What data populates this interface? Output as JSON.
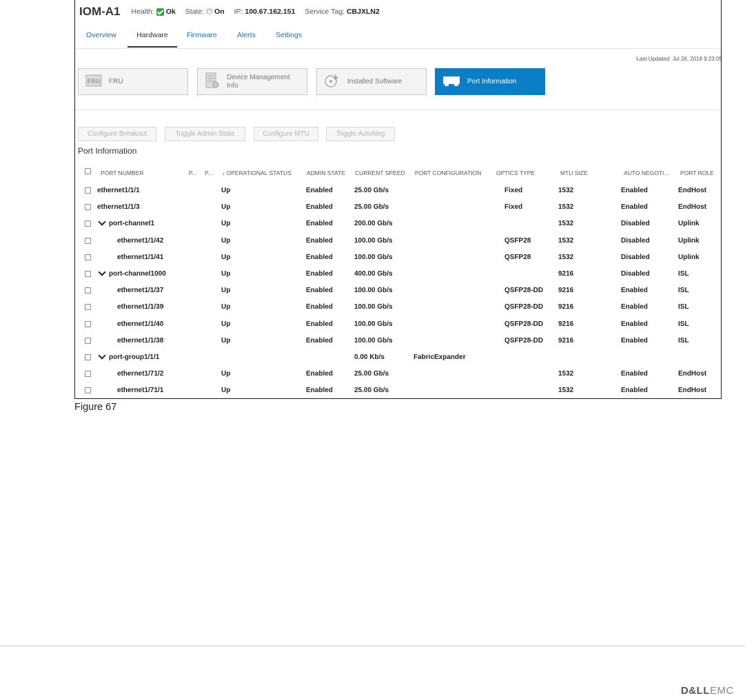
{
  "device": {
    "title": "IOM-A1",
    "health_label": "Health:",
    "health_value": "Ok",
    "state_label": "State:",
    "state_value": "On",
    "ip_label": "IP:",
    "ip_value": "100.67.162.151",
    "service_tag_label": "Service Tag:",
    "service_tag_value": "CBJXLN2"
  },
  "tabs": [
    "Overview",
    "Hardware",
    "Firmware",
    "Alerts",
    "Settings"
  ],
  "active_tab": "Hardware",
  "last_updated": "Last Updated: Jul 26, 2018 9:23:05",
  "cards": [
    {
      "label": "FRU",
      "icon": "fru-icon"
    },
    {
      "label": "Device Management Info",
      "icon": "device-management-icon"
    },
    {
      "label": "Installed Software",
      "icon": "installed-software-icon"
    },
    {
      "label": "Port Information",
      "icon": "port-information-icon"
    }
  ],
  "active_card": "Port Information",
  "actions": [
    "Configure Breakout",
    "Toggle Admin State",
    "Configure MTU",
    "Toggle AutoNeg"
  ],
  "section_title": "Port Information",
  "columns": {
    "port_number": "PORT NUMBER",
    "p1": "P...",
    "p2": "P...",
    "operational_status": "OPERATIONAL STATUS",
    "admin_state": "ADMIN STATE",
    "current_speed": "CURRENT SPEED",
    "port_configuration": "PORT CONFIGURATION",
    "optics_type": "OPTICS TYPE",
    "mtu_size": "MTU SIZE",
    "auto_negotiation": "AUTO NEGOTI...",
    "port_role": "PORT ROLE"
  },
  "sort_indicator": "↓",
  "rows": [
    {
      "port": "ethernet1/1/1",
      "level": 0,
      "expandable": false,
      "status": "Up",
      "admin": "Enabled",
      "speed": "25.00 Gb/s",
      "config": "",
      "optics": "Fixed",
      "mtu": "1532",
      "autoneg": "Enabled",
      "role": "EndHost"
    },
    {
      "port": "ethernet1/1/3",
      "level": 0,
      "expandable": false,
      "status": "Up",
      "admin": "Enabled",
      "speed": "25.00 Gb/s",
      "config": "",
      "optics": "Fixed",
      "mtu": "1532",
      "autoneg": "Enabled",
      "role": "EndHost"
    },
    {
      "port": "port-channel1",
      "level": 0,
      "expandable": true,
      "status": "Up",
      "admin": "Enabled",
      "speed": "200.00 Gb/s",
      "config": "",
      "optics": "",
      "mtu": "1532",
      "autoneg": "Disabled",
      "role": "Uplink"
    },
    {
      "port": "ethernet1/1/42",
      "level": 1,
      "expandable": false,
      "status": "Up",
      "admin": "Enabled",
      "speed": "100.00 Gb/s",
      "config": "",
      "optics": "QSFP28",
      "mtu": "1532",
      "autoneg": "Disabled",
      "role": "Uplink"
    },
    {
      "port": "ethernet1/1/41",
      "level": 1,
      "expandable": false,
      "status": "Up",
      "admin": "Enabled",
      "speed": "100.00 Gb/s",
      "config": "",
      "optics": "QSFP28",
      "mtu": "1532",
      "autoneg": "Disabled",
      "role": "Uplink"
    },
    {
      "port": "port-channel1000",
      "level": 0,
      "expandable": true,
      "status": "Up",
      "admin": "Enabled",
      "speed": "400.00 Gb/s",
      "config": "",
      "optics": "",
      "mtu": "9216",
      "autoneg": "Disabled",
      "role": "ISL"
    },
    {
      "port": "ethernet1/1/37",
      "level": 1,
      "expandable": false,
      "status": "Up",
      "admin": "Enabled",
      "speed": "100.00 Gb/s",
      "config": "",
      "optics": "QSFP28-DD",
      "mtu": "9216",
      "autoneg": "Enabled",
      "role": "ISL"
    },
    {
      "port": "ethernet1/1/39",
      "level": 1,
      "expandable": false,
      "status": "Up",
      "admin": "Enabled",
      "speed": "100.00 Gb/s",
      "config": "",
      "optics": "QSFP28-DD",
      "mtu": "9216",
      "autoneg": "Enabled",
      "role": "ISL"
    },
    {
      "port": "ethernet1/1/40",
      "level": 1,
      "expandable": false,
      "status": "Up",
      "admin": "Enabled",
      "speed": "100.00 Gb/s",
      "config": "",
      "optics": "QSFP28-DD",
      "mtu": "9216",
      "autoneg": "Enabled",
      "role": "ISL"
    },
    {
      "port": "ethernet1/1/38",
      "level": 1,
      "expandable": false,
      "status": "Up",
      "admin": "Enabled",
      "speed": "100.00 Gb/s",
      "config": "",
      "optics": "QSFP28-DD",
      "mtu": "9216",
      "autoneg": "Enabled",
      "role": "ISL"
    },
    {
      "port": "port-group1/1/1",
      "level": 0,
      "expandable": true,
      "status": "",
      "admin": "",
      "speed": "0.00 Kb/s",
      "config": "FabricExpander",
      "optics": "",
      "mtu": "",
      "autoneg": "",
      "role": ""
    },
    {
      "port": "ethernet1/71/2",
      "level": 1,
      "expandable": false,
      "status": "Up",
      "admin": "Enabled",
      "speed": "25.00 Gb/s",
      "config": "",
      "optics": "",
      "mtu": "1532",
      "autoneg": "Enabled",
      "role": "EndHost"
    },
    {
      "port": "ethernet1/71/1",
      "level": 1,
      "expandable": false,
      "status": "Up",
      "admin": "Enabled",
      "speed": "25.00 Gb/s",
      "config": "",
      "optics": "",
      "mtu": "1532",
      "autoneg": "Enabled",
      "role": "EndHost"
    }
  ],
  "figure_caption": "Figure 67",
  "footer_logo": {
    "part1": "D&LL",
    "part2": "EMC"
  },
  "colors": {
    "accent": "#0b7ec8",
    "link": "#1a6fb5",
    "ok_green": "#39a341"
  }
}
